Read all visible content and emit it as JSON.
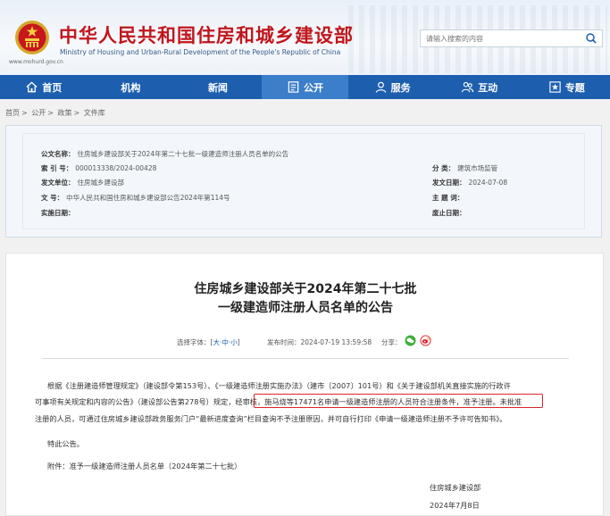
{
  "header": {
    "site_title": "中华人民共和国住房和城乡建设部",
    "site_subtitle": "Ministry of Housing and Urban-Rural Development of the People's Republic of China",
    "url": "www.mohurd.gov.cn",
    "search_placeholder": "请输入搜索的内容"
  },
  "nav": [
    {
      "label": "首页",
      "icon": "home-icon"
    },
    {
      "label": "机构",
      "icon": ""
    },
    {
      "label": "新闻",
      "icon": ""
    },
    {
      "label": "公开",
      "icon": "document-icon"
    },
    {
      "label": "服务",
      "icon": "user-icon"
    },
    {
      "label": "互动",
      "icon": "people-icon"
    },
    {
      "label": "专题",
      "icon": "star-icon"
    }
  ],
  "breadcrumb": [
    "首页",
    "公开",
    "政策",
    "文件库"
  ],
  "meta": {
    "name_label": "公文名称：",
    "name_value": "住房城乡建设部关于2024年第二十七批一级建造师注册人员名单的公告",
    "index_label": "索 引 号：",
    "index_value": "000013338/2024-00428",
    "category_label": "分    类：",
    "category_value": "建筑市场监管",
    "issuer_label": "发文单位：",
    "issuer_value": "住房城乡建设部",
    "date_label": "发文日期：",
    "date_value": "2024-07-08",
    "docno_label": "文    号：",
    "docno_value": "中华人民共和国住房和城乡建设部公告2024年第114号",
    "topic_label": "主 题 词：",
    "topic_value": "",
    "impl_label": "实施日期：",
    "impl_value": "",
    "abolish_label": "废止日期：",
    "abolish_value": ""
  },
  "article": {
    "title_line1": "住房城乡建设部关于2024年第二十七批",
    "title_line2": "一级建造师注册人员名单的公告",
    "font_label": "选择字体：[",
    "font_large": "大",
    "font_medium": "中",
    "font_small": "小",
    "font_close": "]",
    "publish_label": "发布时间：",
    "publish_time": "2024-07-19 13:59:58",
    "share_label": "分享：",
    "para1_line1": "根据《注册建造师管理规定》（建设部令第153号）、《一级建造师注册实施办法》（建市〔2007〕101号）和《关于建设部机关直接实施的行政许",
    "para1_line2a": "可事项有关规定和内容的公告》（建设部公告第278号）规定，",
    "para1_line2b": "经审核，施马烧等17471名申请一级建造师注册的人员符合注册条件，准予注册。",
    "para1_line2c": "未批准",
    "para1_line3": "注册的人员，可通过住房城乡建设部政务服务门户“最新进度查询”栏目查询不予注册原因，并可自行打印《申请一级建造师注册不予许可告知书》。",
    "para2": "特此公告。",
    "attachment": "附件：准予一级建造师注册人员名单（2024年第二十七批）",
    "signature": "住房城乡建设部",
    "sign_date": "2024年7月8日"
  },
  "colors": {
    "brand_red": "#c0161c",
    "nav_blue": "#1d5fae",
    "highlight": "#d9262b"
  }
}
